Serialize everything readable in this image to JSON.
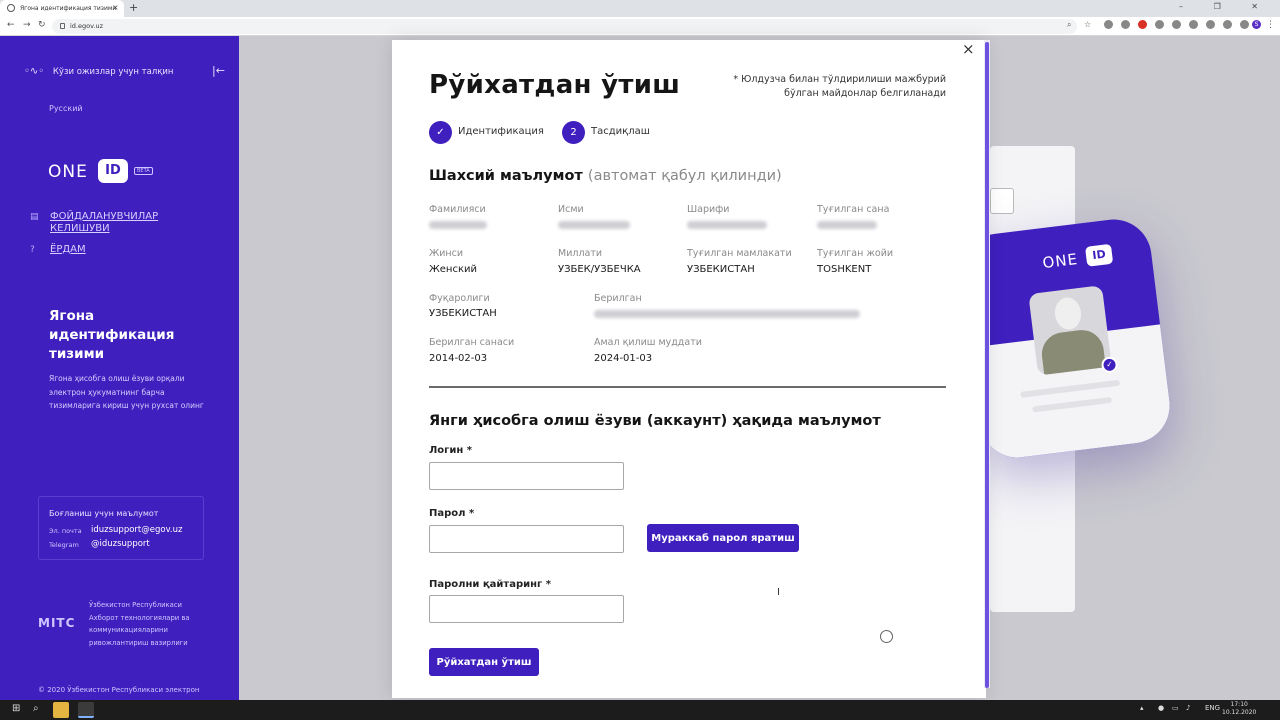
{
  "browser": {
    "tab_title": "Ягона идентификация тизими",
    "tab_close": "×",
    "new_tab": "+",
    "url": "id.egov.uz",
    "win_controls": "– ❐ ✕"
  },
  "sidebar": {
    "skip_link": "Кўзи ожизлар учун талқин",
    "language": "Русский",
    "logo_text": "ONE",
    "logo_id": "ID",
    "logo_badge": "BETA",
    "link_agreement": "ФОЙДАЛАНУВЧИЛАР КЕЛИШУВИ",
    "link_help": "ЁРДАМ",
    "system_title": "Ягона идентификация тизими",
    "system_desc": "Ягона ҳисобга олиш ёзуви орқали электрон ҳукуматнинг барча тизимларига кириш учун рухсат олинг",
    "contact": {
      "title": "Боғланиш учун маълумот",
      "email_label": "Эл. почта",
      "email": "iduzsupport@egov.uz",
      "telegram_label": "Telegram",
      "telegram": "@iduzsupport"
    },
    "mitc_logo": "MITC",
    "ministry": "Ўзбекистон Республикаси Ахборот технологиялари ва коммуникацияларини ривожлантириш вазирлиги",
    "footer": "© 2020 Ўзбекистон Республикаси электрон"
  },
  "illustration": {
    "one": "ONE",
    "id": "ID"
  },
  "modal": {
    "close": "×",
    "title": "Рўйхатдан ўтиш",
    "required_note": "* Юлдузча билан тўлдирилиши мажбурий бўлган майдонлар белгиланади",
    "steps": [
      {
        "marker": "✓",
        "label": "Идентификация"
      },
      {
        "marker": "2",
        "label": "Тасдиқлаш"
      }
    ],
    "personal_title": "Шахсий маълумот",
    "personal_title_note": "(автомат қабул қилинди)",
    "fields": {
      "surname": {
        "label": "Фамилияси"
      },
      "name": {
        "label": "Исми"
      },
      "patronymic": {
        "label": "Шарифи"
      },
      "birth_date": {
        "label": "Туғилган сана"
      },
      "gender": {
        "label": "Жинси",
        "value": "Женский"
      },
      "nationality": {
        "label": "Миллати",
        "value": "УЗБЕК/УЗБЕЧКА"
      },
      "birth_country": {
        "label": "Туғилган мамлакати",
        "value": "УЗБЕКИСТАН"
      },
      "birth_place": {
        "label": "Туғилган жойи",
        "value": "TOSHKENT"
      },
      "citizenship": {
        "label": "Фуқаролиги",
        "value": "УЗБЕКИСТАН"
      },
      "issued_by": {
        "label": "Берилган"
      },
      "issue_date": {
        "label": "Берилган санаси",
        "value": "2014-02-03"
      },
      "expiry_date": {
        "label": "Амал қилиш муддати",
        "value": "2024-01-03"
      }
    },
    "account_title": "Янги ҳисобга олиш ёзуви (аккаунт) ҳақида маълумот",
    "login_label": "Логин *",
    "login_value": "",
    "password_label": "Парол *",
    "password_value": "",
    "generate_password_button": "Мураккаб парол яратиш",
    "repeat_password_label": "Паролни қайтаринг *",
    "repeat_password_value": "",
    "submit_button": "Рўйхатдан ўтиш",
    "cursor": "I"
  },
  "taskbar": {
    "tray_lang": "ENG",
    "time": "17:10",
    "date": "10.12.2020"
  },
  "colors": {
    "brand": "#3f1fbe",
    "sidebar_text": "#d7d0ff"
  }
}
